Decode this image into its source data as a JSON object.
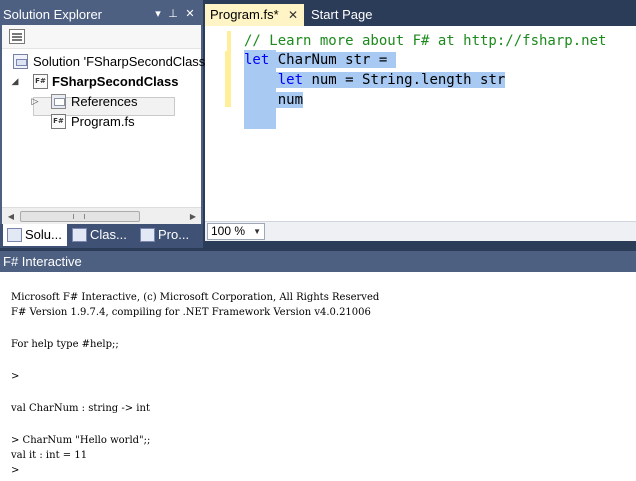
{
  "solution_explorer": {
    "title": "Solution Explorer",
    "window_buttons": {
      "dropdown": "▾",
      "pin": "⊥",
      "close": "✕"
    },
    "tree": {
      "solution": "Solution 'FSharpSecondClass",
      "project": "FSharpSecondClass",
      "references": "References",
      "file": "Program.fs"
    },
    "bottom_tabs": [
      "Solu...",
      "Clas...",
      "Pro..."
    ]
  },
  "editor": {
    "tabs": [
      {
        "label": "Program.fs*",
        "active": true
      },
      {
        "label": "Start Page",
        "active": false
      }
    ],
    "code": {
      "comment": "// Learn more about F# at http://fsharp.net",
      "line1_kw": "let",
      "line1_rest": " CharNum str = ",
      "line2_indent": "    ",
      "line2_kw": "let",
      "line2_rest": " num = String.length str",
      "line3_indent": "    ",
      "line3_rest": "num"
    },
    "zoom": "100 %"
  },
  "fsi": {
    "title": "F# Interactive",
    "lines": [
      "Microsoft F# Interactive, (c) Microsoft Corporation, All Rights Reserved",
      "F# Version 1.9.7.4, compiling for .NET Framework Version v4.0.21006",
      "For help type #help;;",
      ">",
      "val CharNum : string -> int",
      "> CharNum \"Hello world\";;",
      "val it : int = 11",
      ">"
    ]
  },
  "colors": {
    "chrome_dark": "#2b3c59",
    "chrome_title": "#4d6082",
    "active_tab": "#fff4c6",
    "selection": "#a7c9f2",
    "comment": "#1c8a1c",
    "keyword": "#0000ff"
  }
}
